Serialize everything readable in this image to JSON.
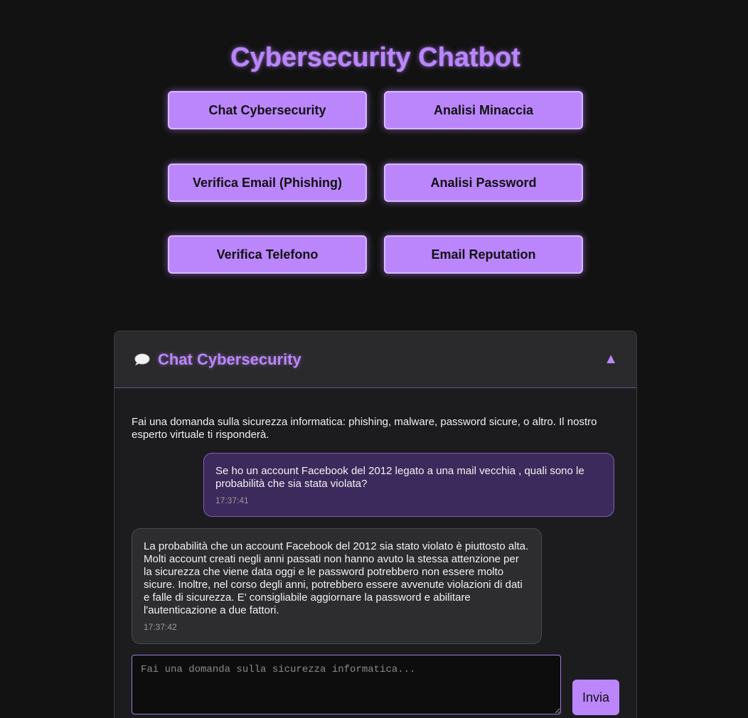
{
  "app": {
    "title": "Cybersecurity Chatbot"
  },
  "nav": {
    "buttons": [
      {
        "label": "Chat Cybersecurity"
      },
      {
        "label": "Analisi Minaccia"
      },
      {
        "label": "Verifica Email (Phishing)"
      },
      {
        "label": "Analisi Password"
      },
      {
        "label": "Verifica Telefono"
      },
      {
        "label": "Email Reputation"
      }
    ]
  },
  "chat_panel": {
    "icon": "speech-bubble-icon",
    "title": "Chat Cybersecurity",
    "toggle_symbol": "▲",
    "intro": "Fai una domanda sulla sicurezza informatica: phishing, malware, password sicure, o altro. Il nostro esperto virtuale ti risponderà.",
    "messages": [
      {
        "role": "user",
        "text": "Se ho un account Facebook del 2012 legato a una mail vecchia , quali sono le probabilità che sia stata violata?",
        "time": "17:37:41"
      },
      {
        "role": "bot",
        "text": "La probabilità che un account Facebook del 2012 sia stato violato è piuttosto alta. Molti account creati negli anni passati non hanno avuto la stessa attenzione per la sicurezza che viene data oggi e le password potrebbero non essere molto sicure. Inoltre, nel corso degli anni, potrebbero essere avvenute violazioni di dati e falle di sicurezza. E' consigliabile aggiornare la password e abilitare l'autenticazione a due fattori.",
        "time": "17:37:42"
      }
    ],
    "input": {
      "value": "",
      "placeholder": "Fai una domanda sulla sicurezza informatica..."
    },
    "send_label": "Invia"
  },
  "colors": {
    "background": "#121212",
    "accent": "#bb86fc",
    "user_bubble": "#3d2a5c",
    "bot_bubble": "#2d2d2f"
  }
}
